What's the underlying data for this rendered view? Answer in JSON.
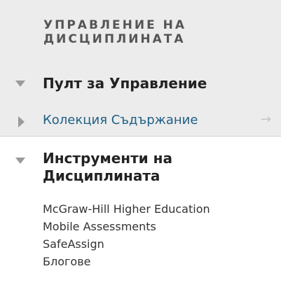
{
  "section": {
    "title": "УПРАВЛЕНИЕ НА ДИСЦИПЛИНАТА"
  },
  "menu": {
    "control_panel": {
      "label": "Пулт за Управление",
      "expanded": true
    },
    "content_collection": {
      "label": "Колекция Съдържание",
      "expanded": false
    },
    "course_tools": {
      "label": "Инструменти на Дисциплината",
      "expanded": true,
      "items": [
        {
          "label": "McGraw-Hill Higher Education"
        },
        {
          "label": "Mobile Assessments"
        },
        {
          "label": "SafeAssign"
        },
        {
          "label": "Блогове"
        }
      ]
    }
  },
  "colors": {
    "band_background": "#ececec",
    "link": "#1f5f86",
    "heading": "#222222",
    "section_title": "#555555",
    "toggle_triangle": "#9a9a9a"
  },
  "icons": {
    "expanded": "triangle-down-icon",
    "collapsed": "triangle-right-icon",
    "content_collection_arrow": "arrow-right-icon"
  }
}
